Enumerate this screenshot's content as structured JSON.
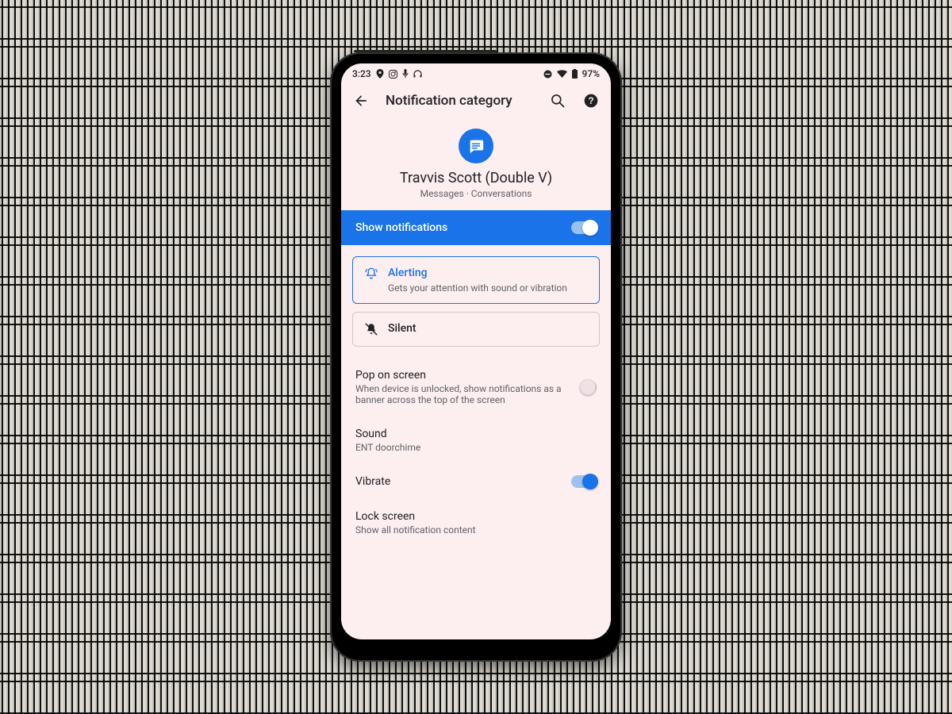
{
  "status": {
    "time": "3:23",
    "battery": "97%"
  },
  "appbar": {
    "title": "Notification category"
  },
  "header": {
    "contact_name": "Travvis Scott (Double V)",
    "subtitle": "Messages · Conversations"
  },
  "master": {
    "label": "Show notifications"
  },
  "modes": {
    "alerting": {
      "label": "Alerting",
      "desc": "Gets your attention with sound or vibration"
    },
    "silent": {
      "label": "Silent"
    }
  },
  "settings": {
    "pop": {
      "title": "Pop on screen",
      "sub": "When device is unlocked, show notifications as a banner across the top of the screen"
    },
    "sound": {
      "title": "Sound",
      "sub": "ENT doorchime"
    },
    "vibrate": {
      "title": "Vibrate"
    },
    "lockscreen": {
      "title": "Lock screen",
      "sub": "Show all notification content"
    }
  }
}
